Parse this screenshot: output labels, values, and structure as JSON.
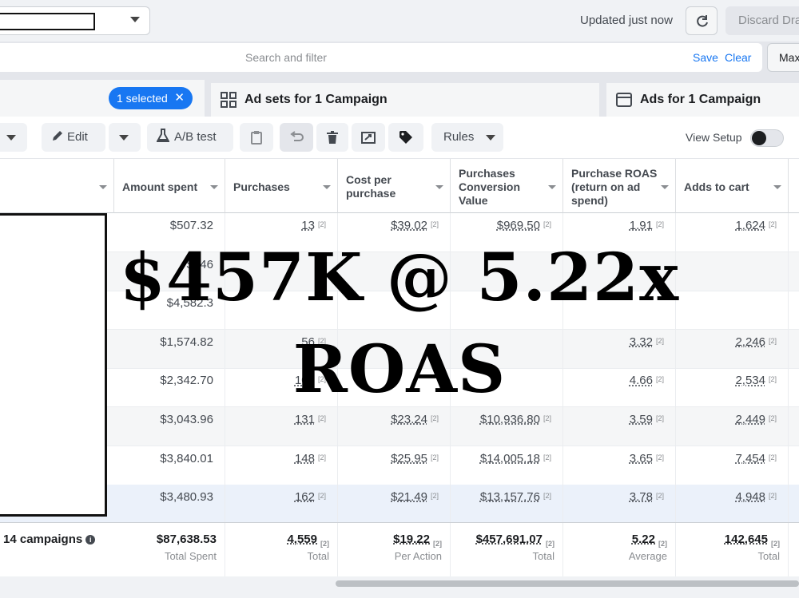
{
  "header": {
    "updated_text": "Updated just now",
    "discard_label": "Discard Dra"
  },
  "search": {
    "placeholder": "Search and filter",
    "save_label": "Save",
    "clear_label": "Clear",
    "max_label": "Max"
  },
  "tabs": {
    "selected_pill": "1 selected",
    "adsets_label": "Ad sets for 1 Campaign",
    "ads_label": "Ads for 1 Campaign"
  },
  "toolbar": {
    "edit_label": "Edit",
    "abtest_label": "A/B test",
    "rules_label": "Rules",
    "view_setup_label": "View Setup"
  },
  "table": {
    "columns": [
      {
        "key": "amount_spent",
        "label": "Amount spent"
      },
      {
        "key": "purchases",
        "label": "Purchases"
      },
      {
        "key": "cost_per_purchase",
        "label": "Cost per purchase"
      },
      {
        "key": "purchases_conversion_value",
        "label": "Purchases Conversion Value"
      },
      {
        "key": "purchase_roas",
        "label": "Purchase ROAS (return on ad spend)"
      },
      {
        "key": "adds_to_cart",
        "label": "Adds to cart"
      }
    ],
    "footnote_marker": "[2]",
    "rows": [
      {
        "amount_spent": "$507.32",
        "purchases": "13",
        "cost_per_purchase": "$39.02",
        "purchases_conversion_value": "$969.50",
        "purchase_roas": "1.91",
        "adds_to_cart": "1,624"
      },
      {
        "amount_spent": "$946",
        "purchases": "",
        "cost_per_purchase": "",
        "purchases_conversion_value": "",
        "purchase_roas": "",
        "adds_to_cart": ""
      },
      {
        "amount_spent": "$4,582.3",
        "purchases": "",
        "cost_per_purchase": "",
        "purchases_conversion_value": "",
        "purchase_roas": "",
        "adds_to_cart": ""
      },
      {
        "amount_spent": "$1,574.82",
        "purchases": "56",
        "cost_per_purchase": "",
        "purchases_conversion_value": "",
        "purchase_roas": "3.32",
        "adds_to_cart": "2,246"
      },
      {
        "amount_spent": "$2,342.70",
        "purchases": "108",
        "cost_per_purchase": "",
        "purchases_conversion_value": "",
        "purchase_roas": "4.66",
        "adds_to_cart": "2,534"
      },
      {
        "amount_spent": "$3,043.96",
        "purchases": "131",
        "cost_per_purchase": "$23.24",
        "purchases_conversion_value": "$10,936.80",
        "purchase_roas": "3.59",
        "adds_to_cart": "2,449"
      },
      {
        "amount_spent": "$3,840.01",
        "purchases": "148",
        "cost_per_purchase": "$25.95",
        "purchases_conversion_value": "$14,005.18",
        "purchase_roas": "3.65",
        "adds_to_cart": "7,454"
      },
      {
        "amount_spent": "$3,480.93",
        "purchases": "162",
        "cost_per_purchase": "$21.49",
        "purchases_conversion_value": "$13,157.76",
        "purchase_roas": "3.78",
        "adds_to_cart": "4,948"
      }
    ],
    "totals": {
      "label": "14 campaigns",
      "amount_spent": {
        "value": "$87,638.53",
        "sub": "Total Spent"
      },
      "purchases": {
        "value": "4,559",
        "sub": "Total"
      },
      "cost_per_purchase": {
        "value": "$19.22",
        "sub": "Per Action"
      },
      "purchases_conversion_value": {
        "value": "$457,691.07",
        "sub": "Total"
      },
      "purchase_roas": {
        "value": "5.22",
        "sub": "Average"
      },
      "adds_to_cart": {
        "value": "142,645",
        "sub": "Total"
      }
    }
  },
  "overlay": {
    "line1": "$457K @ 5.22x",
    "line2": "ROAS"
  }
}
